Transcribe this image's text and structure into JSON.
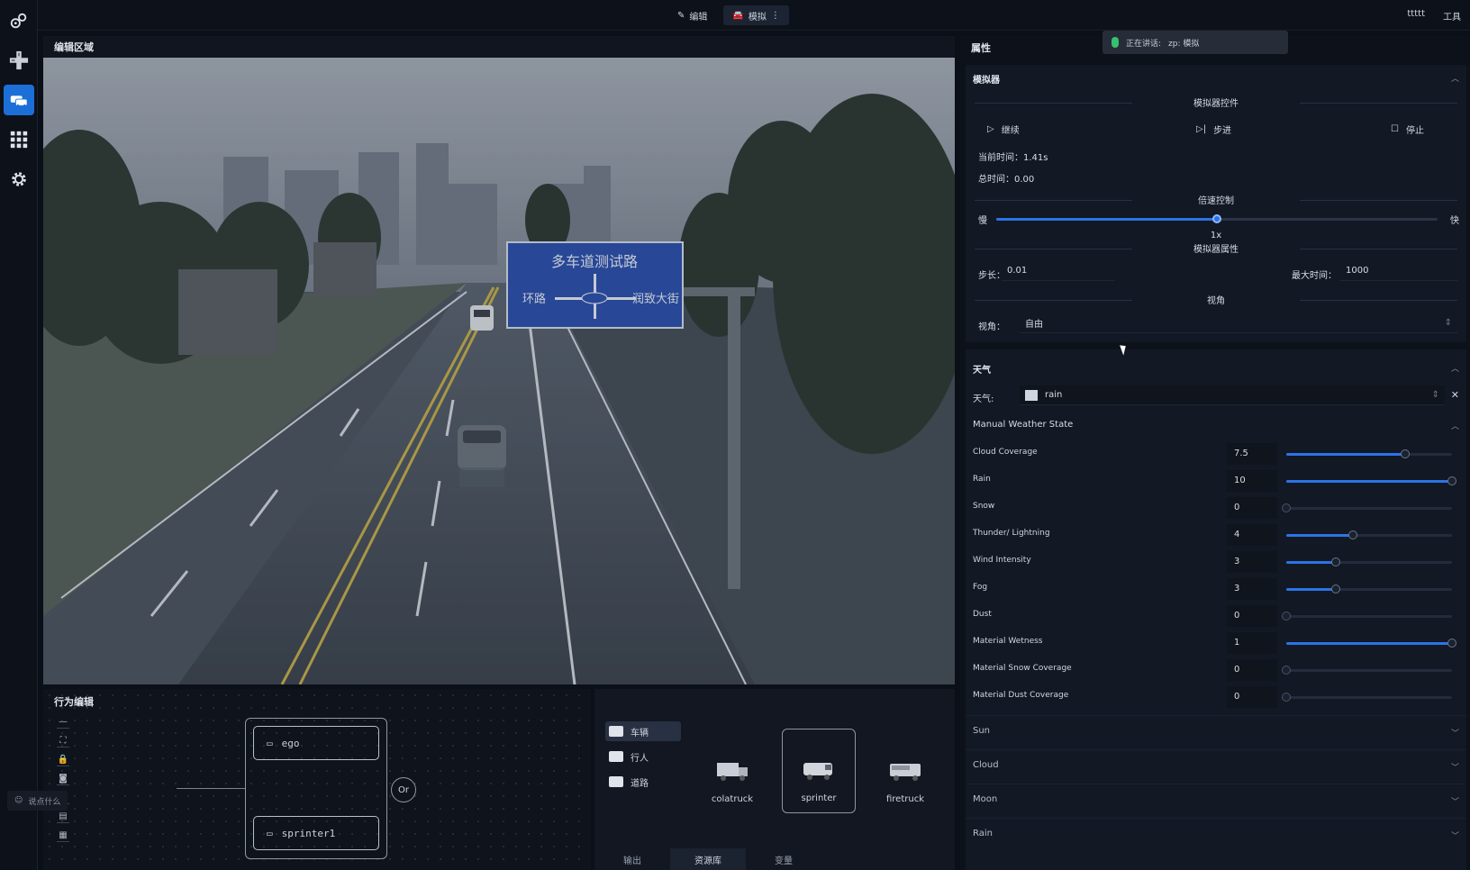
{
  "rail": {
    "icons": [
      "gears-icon",
      "crossroad-icon",
      "vehicles-icon",
      "grid-icon",
      "settings-icon"
    ],
    "active_index": 2,
    "accent": "#1d6fd8"
  },
  "topbar": {
    "tabs": [
      {
        "label": "编辑",
        "icon": "pencil-icon",
        "active": false
      },
      {
        "label": "模拟",
        "icon": "car-icon",
        "active": true
      }
    ],
    "right": [
      "ttttt",
      "工具"
    ]
  },
  "edit_area": {
    "title": "编辑区域",
    "road_sign": {
      "title": "多车道测试路",
      "left": "环路",
      "right": "润致大街",
      "center_top": "",
      "center_bottom": ""
    }
  },
  "behavior": {
    "title": "行为编辑",
    "tools": [
      "—",
      "⛶",
      "🔒",
      "◙",
      "▣",
      "▤",
      "▦"
    ],
    "nodes": [
      "ego",
      "sprinter1"
    ],
    "or_label": "Or",
    "voice_hint": "说点什么"
  },
  "assets": {
    "folders": [
      {
        "label": "车辆",
        "active": true
      },
      {
        "label": "行人",
        "active": false
      },
      {
        "label": "道路",
        "active": false
      }
    ],
    "items": [
      {
        "label": "colatruck",
        "selected": false
      },
      {
        "label": "sprinter",
        "selected": true
      },
      {
        "label": "firetruck",
        "selected": false
      }
    ],
    "tabs": [
      {
        "label": "输出",
        "active": false
      },
      {
        "label": "资源库",
        "active": true
      },
      {
        "label": "变量",
        "active": false
      }
    ]
  },
  "props": {
    "title": "属性",
    "voice": {
      "status": "正在讲话:",
      "text": "zp: 模拟"
    }
  },
  "simulator": {
    "title": "模拟器",
    "controls_header": "模拟器控件",
    "continue": "继续",
    "step": "步进",
    "stop": "停止",
    "current_time": "当前时间：1.41s",
    "total_time": "总时间：0.00",
    "speed_header": "倍速控制",
    "slow": "慢",
    "fast": "快",
    "speed_value": "1x",
    "speed_fraction": 0.5,
    "props_header": "模拟器属性",
    "step_label": "步长：",
    "step_value": "0.01",
    "max_time_label": "最大时间：",
    "max_time_value": "1000",
    "view_header": "视角",
    "view_label": "视角：",
    "view_value": "自由"
  },
  "weather": {
    "title": "天气",
    "label": "天气:",
    "value": "rain",
    "manual_title": "Manual Weather State",
    "params": [
      {
        "label": "Cloud Coverage",
        "value": "7.5",
        "fraction": 0.72
      },
      {
        "label": "Rain",
        "value": "10",
        "fraction": 1.0
      },
      {
        "label": "Snow",
        "value": "0",
        "fraction": 0.0
      },
      {
        "label": "Thunder/ Lightning",
        "value": "4",
        "fraction": 0.4
      },
      {
        "label": "Wind Intensity",
        "value": "3",
        "fraction": 0.3
      },
      {
        "label": "Fog",
        "value": "3",
        "fraction": 0.3
      },
      {
        "label": "Dust",
        "value": "0",
        "fraction": 0.0
      },
      {
        "label": "Material Wetness",
        "value": "1",
        "fraction": 1.0
      },
      {
        "label": "Material Snow Coverage",
        "value": "0",
        "fraction": 0.0
      },
      {
        "label": "Material Dust Coverage",
        "value": "0",
        "fraction": 0.0
      }
    ],
    "collapsed": [
      "Sun",
      "Cloud",
      "Moon",
      "Rain"
    ]
  }
}
